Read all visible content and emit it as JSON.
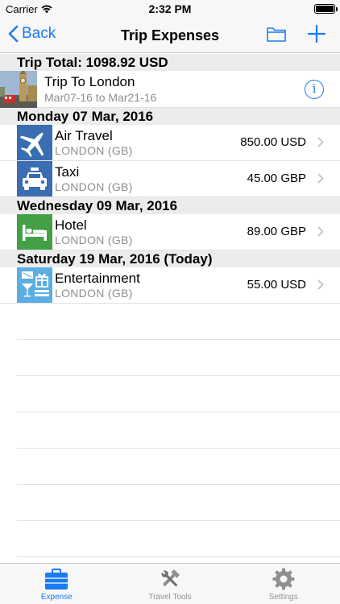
{
  "status_bar": {
    "carrier": "Carrier",
    "time": "2:32 PM"
  },
  "nav": {
    "back_label": "Back",
    "title": "Trip Expenses",
    "accent_color": "#1a7bf3"
  },
  "trip_total": "Trip Total: 1098.92 USD",
  "trip": {
    "name": "Trip To London",
    "dates": "Mar07-16 to Mar21-16",
    "info_glyph": "i"
  },
  "sections": [
    {
      "date": "Monday 07 Mar, 2016",
      "items": [
        {
          "category": "Air Travel",
          "location": "LONDON (GB)",
          "amount": "850.00 USD",
          "icon": "airplane-icon",
          "icon_bg": "#3a6db2"
        },
        {
          "category": "Taxi",
          "location": "LONDON (GB)",
          "amount": "45.00 GBP",
          "icon": "taxi-icon",
          "icon_bg": "#3a6db2"
        }
      ]
    },
    {
      "date": "Wednesday 09 Mar, 2016",
      "items": [
        {
          "category": "Hotel",
          "location": "LONDON (GB)",
          "amount": "89.00 GBP",
          "icon": "bed-icon",
          "icon_bg": "#43a047"
        }
      ]
    },
    {
      "date": "Saturday 19 Mar, 2016 (Today)",
      "items": [
        {
          "category": "Entertainment",
          "location": "LONDON (GB)",
          "amount": "55.00 USD",
          "icon": "entertainment-icon",
          "icon_bg": "#5aaee3"
        }
      ]
    }
  ],
  "tabs": [
    {
      "label": "Expense",
      "icon": "suitcase-icon",
      "active": true
    },
    {
      "label": "Travel Tools",
      "icon": "tools-icon",
      "active": false
    },
    {
      "label": "Settings",
      "icon": "gear-icon",
      "active": false
    }
  ]
}
